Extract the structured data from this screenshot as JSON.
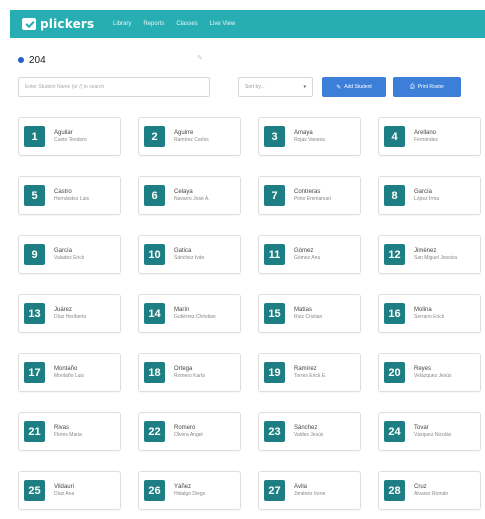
{
  "app": {
    "logo_text": "plickers",
    "nav": [
      "Library",
      "Reports",
      "Classes",
      "Live View"
    ]
  },
  "classroom": {
    "name": "204",
    "dot_color": "#2060c8"
  },
  "toolbar": {
    "search_placeholder": "Enter Student Name (or /) to search",
    "sort_label": "Sort by...",
    "add_label": "Add Student",
    "print_label": "Print Roster"
  },
  "colors": {
    "topbar": "#27aeb3",
    "card_number": "#1d7f83",
    "button": "#3d7fd8"
  },
  "students": [
    {
      "num": "1",
      "last": "Aguilar",
      "first": "Cueto Teodoro"
    },
    {
      "num": "2",
      "last": "Aguirre",
      "first": "Ramírez Carlos"
    },
    {
      "num": "3",
      "last": "Amaya",
      "first": "Rojas Vanesa"
    },
    {
      "num": "4",
      "last": "Arellano",
      "first": "Fernández"
    },
    {
      "num": "5",
      "last": "Castro",
      "first": "Hernández Luis"
    },
    {
      "num": "6",
      "last": "Celaya",
      "first": "Navarro José A."
    },
    {
      "num": "7",
      "last": "Contreras",
      "first": "Pinto Emmanuel"
    },
    {
      "num": "8",
      "last": "García",
      "first": "López Irma"
    },
    {
      "num": "9",
      "last": "García",
      "first": "Valadez Erick"
    },
    {
      "num": "10",
      "last": "Gatica",
      "first": "Sánchez Iván"
    },
    {
      "num": "11",
      "last": "Gómez",
      "first": "Gómez Ana"
    },
    {
      "num": "12",
      "last": "Jiménez",
      "first": "San Miguel Jessica"
    },
    {
      "num": "13",
      "last": "Juárez",
      "first": "Díaz Heriberto"
    },
    {
      "num": "14",
      "last": "Marín",
      "first": "Gutiérrez Christian"
    },
    {
      "num": "15",
      "last": "Matías",
      "first": "Ruiz Cristian"
    },
    {
      "num": "16",
      "last": "Molina",
      "first": "Serrano Erick"
    },
    {
      "num": "17",
      "last": "Montaño",
      "first": "Montaño Luis"
    },
    {
      "num": "18",
      "last": "Ortega",
      "first": "Romero Karla"
    },
    {
      "num": "19",
      "last": "Ramírez",
      "first": "Torres Erick E."
    },
    {
      "num": "20",
      "last": "Reyes",
      "first": "Velázquez Jesús"
    },
    {
      "num": "21",
      "last": "Rivas",
      "first": "Flores Maria"
    },
    {
      "num": "22",
      "last": "Romero",
      "first": "Olvera Angel"
    },
    {
      "num": "23",
      "last": "Sánchez",
      "first": "Valdez Jesús"
    },
    {
      "num": "24",
      "last": "Tovar",
      "first": "Vázquez Nicolás"
    },
    {
      "num": "25",
      "last": "Vildauri",
      "first": "Díaz Ana"
    },
    {
      "num": "26",
      "last": "Yáñez",
      "first": "Hidalgo Diego"
    },
    {
      "num": "27",
      "last": "Ávila",
      "first": "Jiménez Irene"
    },
    {
      "num": "28",
      "last": "Cruz",
      "first": "Alvarez Román"
    }
  ]
}
